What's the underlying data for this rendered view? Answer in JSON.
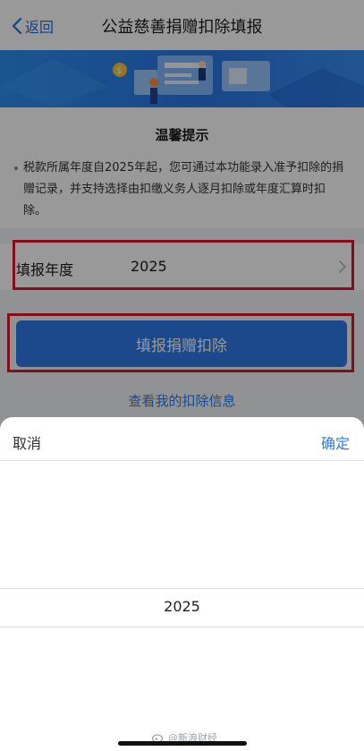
{
  "nav": {
    "back_label": "返回",
    "title": "公益慈善捐赠扣除填报"
  },
  "tip": {
    "title": "温馨提示",
    "text": "税款所属年度自2025年起，您可通过本功能录入准予扣除的捐赠记录，并支持选择由扣缴义务人逐月扣除或年度汇算时扣除。"
  },
  "form": {
    "year_label": "填报年度",
    "year_value": "2025"
  },
  "actions": {
    "primary_label": "填报捐赠扣除",
    "link_label": "查看我的扣除信息"
  },
  "sheet": {
    "cancel_label": "取消",
    "confirm_label": "确定",
    "selected_year": "2025"
  },
  "watermark": {
    "text": "@新浪财经"
  },
  "colors": {
    "accent": "#2d7ae8",
    "highlight_box": "#e0142a",
    "banner": "#2a77e6"
  }
}
